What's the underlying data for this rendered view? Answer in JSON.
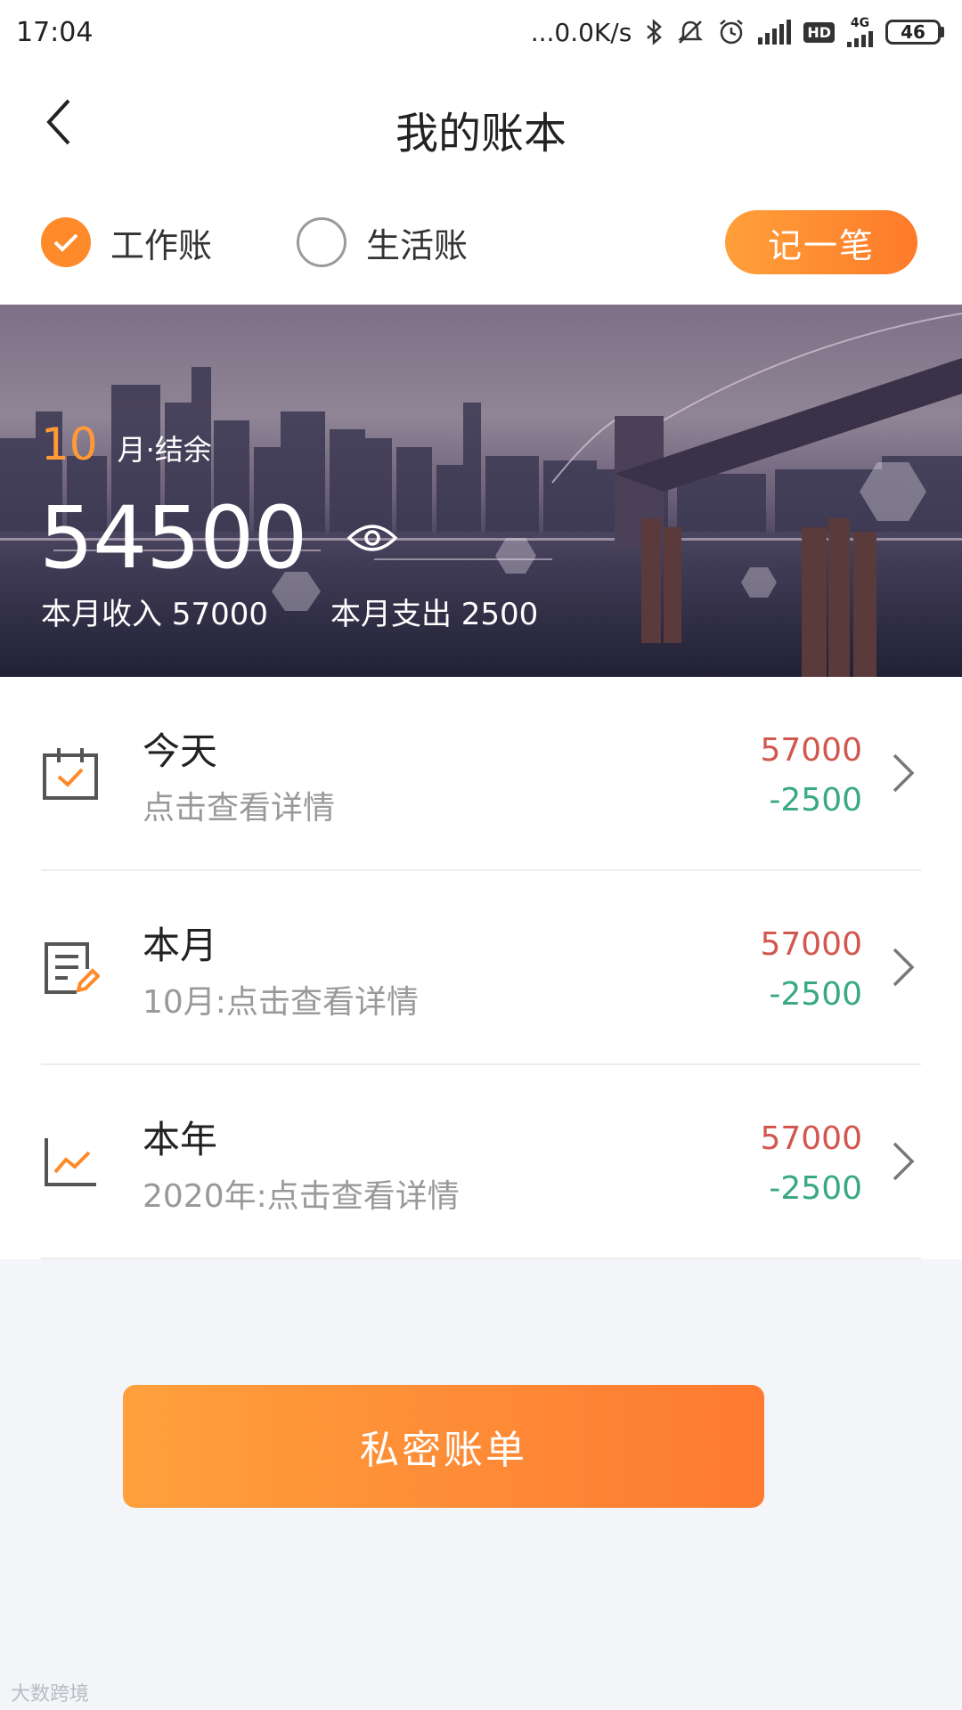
{
  "status_bar": {
    "time": "17:04",
    "network_speed": "...0.0K/s",
    "hd_label": "HD",
    "network_type": "4G",
    "battery": "46",
    "icons": [
      "bluetooth-icon",
      "mute-icon",
      "alarm-icon",
      "signal-icon",
      "hd-icon",
      "signal-4g-icon",
      "battery-icon"
    ]
  },
  "header": {
    "title": "我的账本",
    "back_icon": "chevron-left-icon"
  },
  "book_selector": {
    "options": [
      {
        "label": "工作账",
        "checked": true
      },
      {
        "label": "生活账",
        "checked": false
      }
    ],
    "record_label": "记一笔"
  },
  "banner": {
    "month": "10",
    "month_label": "月·结余",
    "balance": "54500",
    "income_text": "本月收入 57000",
    "expense_text": "本月支出 2500",
    "eye_icon": "eye-icon"
  },
  "summary": {
    "items": [
      {
        "title": "今天",
        "subtitle": "点击查看详情",
        "income": "57000",
        "expense": "-2500",
        "icon": "calendar-check-icon"
      },
      {
        "title": "本月",
        "subtitle": "10月:点击查看详情",
        "income": "57000",
        "expense": "-2500",
        "icon": "note-edit-icon"
      },
      {
        "title": "本年",
        "subtitle": "2020年:点击查看详情",
        "income": "57000",
        "expense": "-2500",
        "icon": "line-chart-icon"
      }
    ]
  },
  "private_button_label": "私密账单",
  "watermark": "大数跨境",
  "colors": {
    "accent": "#fe8a2a",
    "income": "#d2574f",
    "expense": "#38a886"
  }
}
